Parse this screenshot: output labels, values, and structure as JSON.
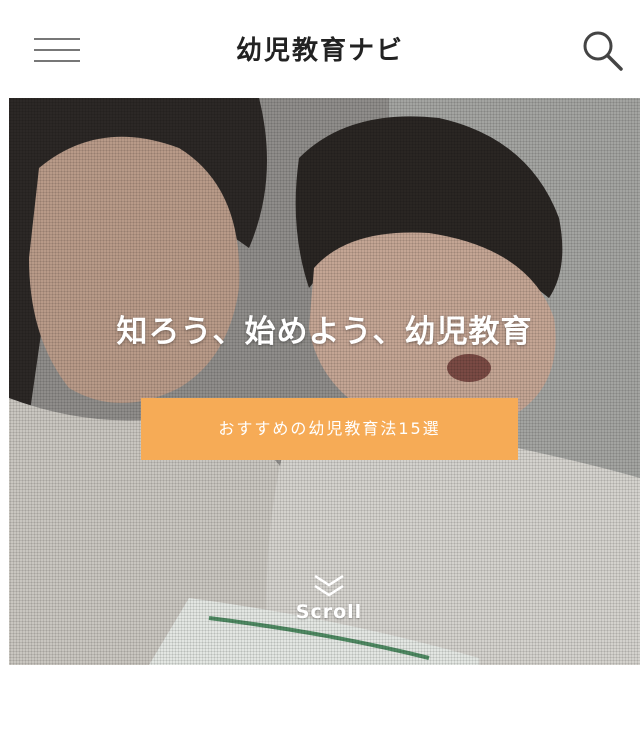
{
  "header": {
    "title": "幼児教育ナビ",
    "menu_icon": "hamburger-menu-icon",
    "search_icon": "search-icon"
  },
  "hero": {
    "tagline": "知ろう、始めよう、幼児教育",
    "cta_label": "おすすめの幼児教育法15選",
    "scroll_label": "Scroll",
    "scroll_icon": "double-chevron-down-icon",
    "image_subject": "mother-and-child-photo"
  },
  "colors": {
    "accent": "#f6ab56",
    "title_text": "#222222",
    "icon_gray": "#777777"
  }
}
